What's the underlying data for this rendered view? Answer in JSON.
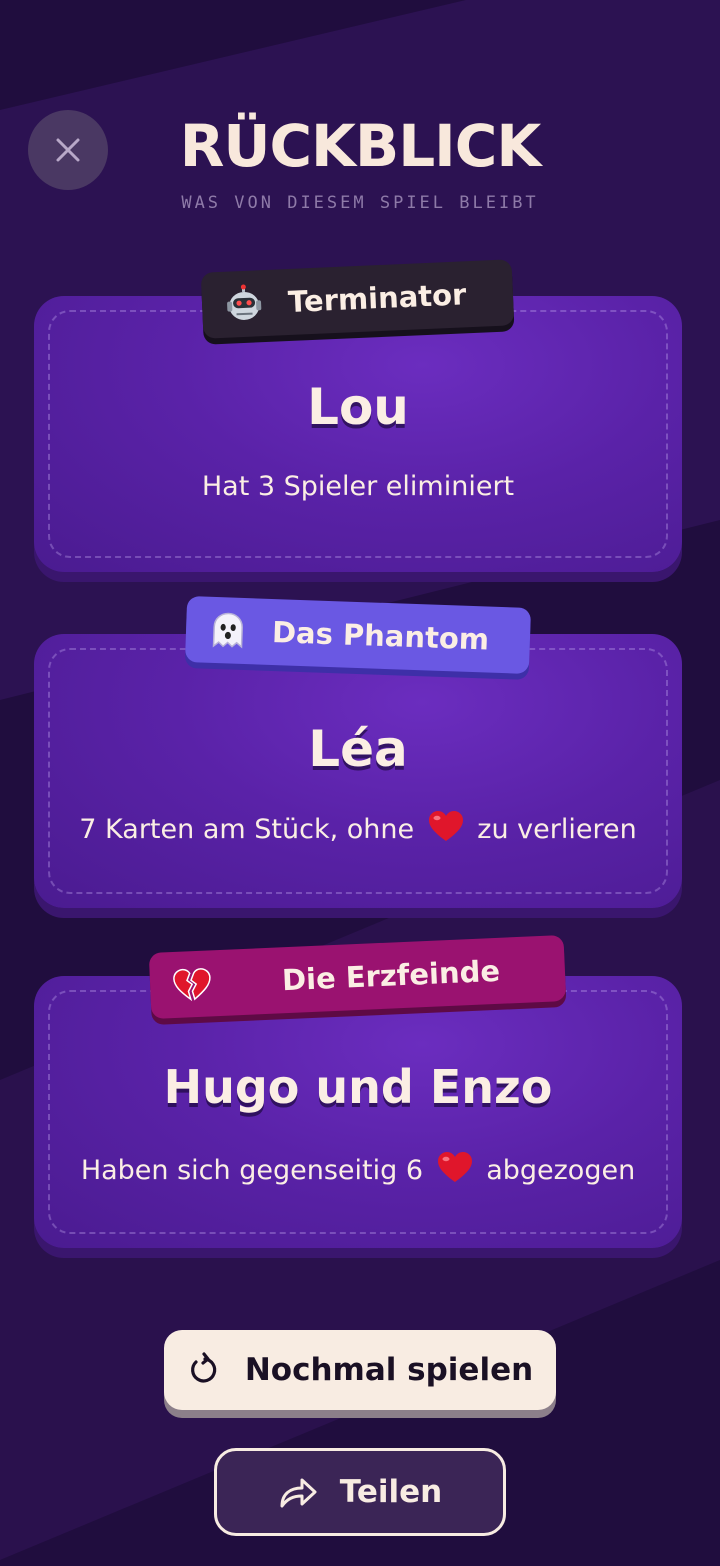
{
  "header": {
    "title": "RÜCKBLICK",
    "subtitle": "WAS VON DIESEM SPIEL BLEIBT"
  },
  "awards": [
    {
      "badge_label": "Terminator",
      "badge_icon": "robot-icon",
      "badge_color": "#2a2130",
      "player": "Lou",
      "description": "Hat 3 Spieler eliminiert"
    },
    {
      "badge_label": "Das Phantom",
      "badge_icon": "ghost-icon",
      "badge_color": "#6a58e3",
      "player": "Léa",
      "description_before": "7 Karten am Stück, ohne",
      "description_icon": "heart-icon",
      "description_after": "zu verlieren"
    },
    {
      "badge_label": "Die Erzfeinde",
      "badge_icon": "broken-heart-icon",
      "badge_color": "#9a1270",
      "player": "Hugo und Enzo",
      "description_before": "Haben sich gegenseitig 6",
      "description_icon": "heart-icon",
      "description_after": "abgezogen"
    }
  ],
  "actions": {
    "play_again_label": "Nochmal spielen",
    "share_label": "Teilen"
  },
  "colors": {
    "background": "#200d3e",
    "card": "#5a22a8",
    "text": "#fbeee4",
    "heart": "#e0162b"
  }
}
